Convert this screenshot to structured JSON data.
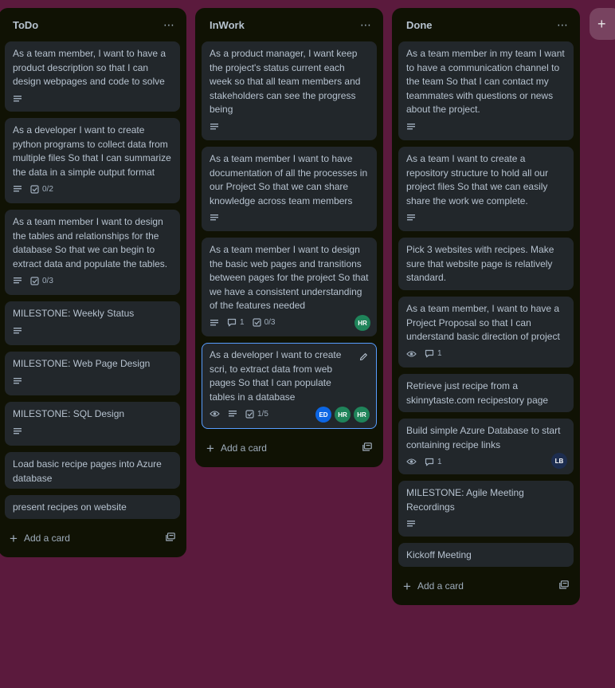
{
  "lists": {
    "todo": {
      "title": "ToDo",
      "menu": "⋯",
      "add_card": "Add a card",
      "cards": [
        {
          "text": "As a team member, I want to have a product description so that I can design webpages and code to solve"
        },
        {
          "text": "As a developer I want to create python programs to collect data from multiple files So that I can summarize the data in a simple output format",
          "checklist": "0/2"
        },
        {
          "text": "As a team member I want to design the tables and relationships for the database So that we can begin to extract data and populate the tables.",
          "checklist": "0/3"
        },
        {
          "text": "MILESTONE: Weekly Status"
        },
        {
          "text": "MILESTONE: Web Page Design"
        },
        {
          "text": "MILESTONE: SQL Design"
        },
        {
          "text": "Load basic recipe pages into Azure database"
        },
        {
          "text": "present recipes on website"
        }
      ]
    },
    "inwork": {
      "title": "InWork",
      "menu": "⋯",
      "add_card": "Add a card",
      "cards": [
        {
          "text": "As a product manager, I want keep the project's status current each week so that all team members and stakeholders can see the progress being"
        },
        {
          "text": "As a team member I want to have documentation of all the processes in our Project So that we can share knowledge across team members"
        },
        {
          "text": "As a team member I want to design the basic web pages and transitions between pages for the project So that we have a consistent understanding of the features needed",
          "comments": "1",
          "checklist": "0/3",
          "members": [
            "HR"
          ]
        },
        {
          "text": "As a developer I want to create scri, to extract data from web pages So that I can populate tables in a database",
          "checklist": "1/5",
          "members": [
            "ED",
            "HR",
            "HR"
          ]
        }
      ]
    },
    "done": {
      "title": "Done",
      "menu": "⋯",
      "add_card": "Add a card",
      "cards": [
        {
          "text": "As a team member in my team I want to have a communication channel to the team So that I can contact my teammates with questions or news about the project."
        },
        {
          "text": "As a team I want to create a repository structure to hold all our project files So that we can easily share the work we complete."
        },
        {
          "text": "Pick 3 websites with recipes. Make sure that website page is relatively standard."
        },
        {
          "text": "As a team member, I want to have a Project Proposal so that I can understand basic direction of project",
          "comments": "1"
        },
        {
          "text": "Retrieve just recipe from a skinnytaste.com recipestory page"
        },
        {
          "text": "Build simple Azure Database to start containing recipe links",
          "comments": "1",
          "members": [
            "LB"
          ]
        },
        {
          "text": "MILESTONE: Agile Meeting Recordings"
        },
        {
          "text": "Kickoff Meeting"
        }
      ]
    }
  },
  "colors": {
    "board_bg": "#5b1a3d",
    "list_bg": "#101204",
    "card_bg": "#22272b",
    "avatar_hr": "#1f845a",
    "avatar_ed": "#0c66e4",
    "avatar_lb": "#1d2d4f"
  },
  "icons": {
    "description": "description-lines-icon",
    "checklist": "checklist-icon",
    "comment": "comment-icon",
    "watch": "eye-icon",
    "edit": "pencil-icon",
    "template": "card-template-icon",
    "add": "plus-icon"
  },
  "add_list_icon": "+"
}
